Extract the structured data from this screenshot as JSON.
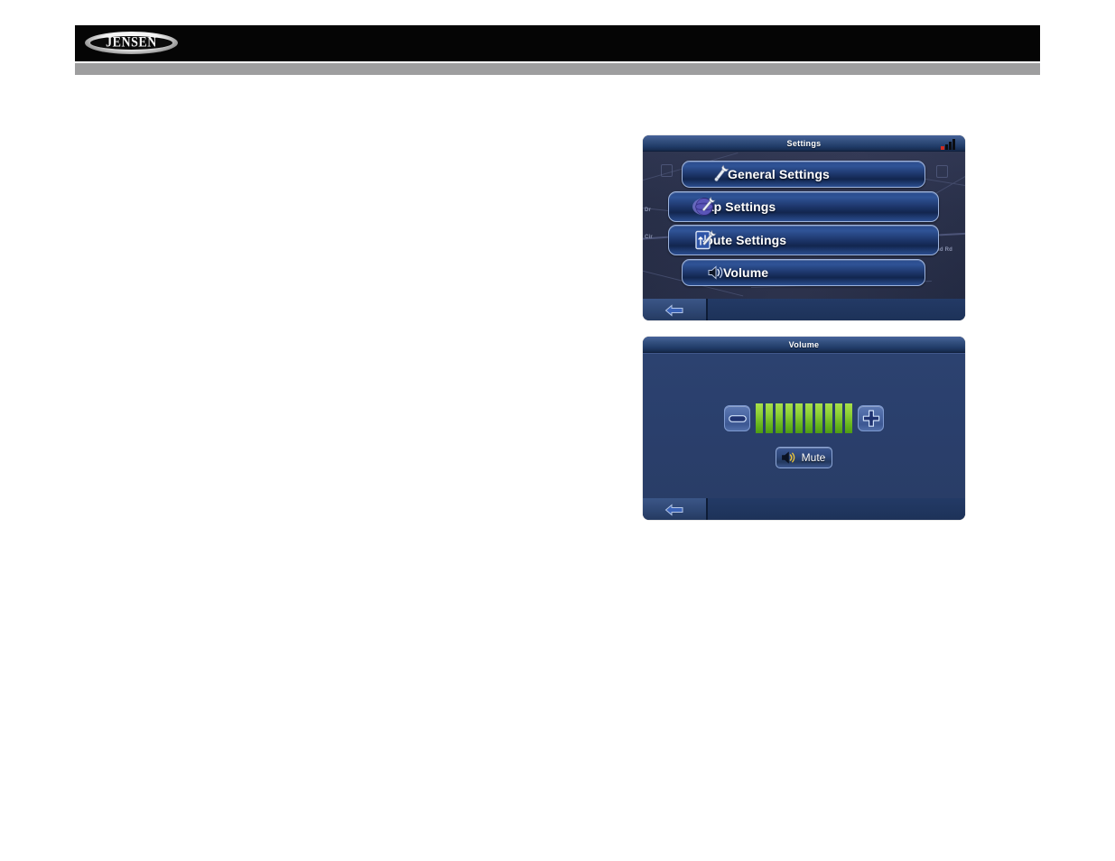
{
  "page": {
    "background_color": "#ffffff",
    "header": {
      "background_color": "#050505",
      "logo_text": "JENSEN",
      "logo_icon": "jensen-oval-logo",
      "accent_bar_color": "#9e9e9f"
    }
  },
  "settings_screen": {
    "title": "Settings",
    "status": {
      "gps_signal_icon": "gps-signal-bars",
      "signal_bars": 3
    },
    "menu_items": [
      {
        "label": "General Settings",
        "icon": "wrench-icon"
      },
      {
        "label": "Map Settings",
        "icon": "globe-wrench-icon"
      },
      {
        "label": "Route Settings",
        "icon": "route-sign-wrench-icon"
      },
      {
        "label": "Volume",
        "icon": "speaker-icon"
      }
    ],
    "bottom_bar": {
      "back_icon": "back-arrow-icon"
    },
    "map_background": {
      "road_labels": [
        "Cir",
        "nd Rd",
        "Dr"
      ]
    }
  },
  "volume_screen": {
    "title": "Volume",
    "decrease_icon": "minus-icon",
    "increase_icon": "plus-icon",
    "volume_level": 10,
    "volume_max": 10,
    "bar_color": "#8ed036",
    "mute": {
      "label": "Mute",
      "icon": "speaker-mute-icon"
    },
    "bottom_bar": {
      "back_icon": "back-arrow-icon"
    }
  }
}
